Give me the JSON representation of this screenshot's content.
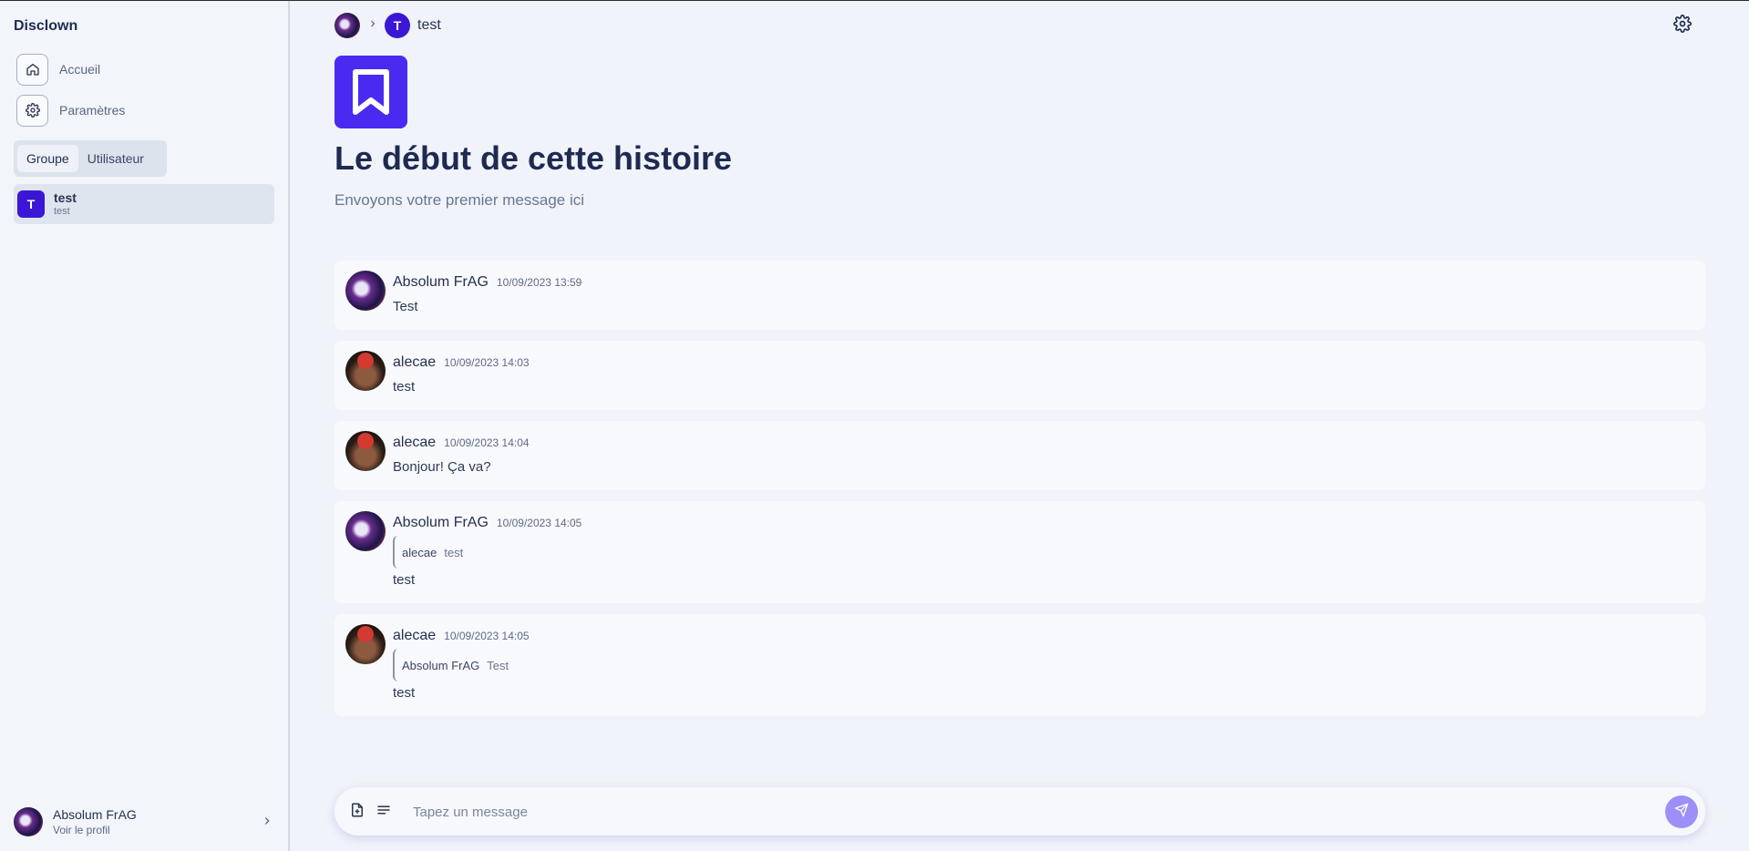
{
  "app": {
    "name": "Disclown"
  },
  "sidebar": {
    "nav": [
      {
        "label": "Accueil",
        "icon": "home-icon"
      },
      {
        "label": "Paramètres",
        "icon": "gear-icon"
      }
    ],
    "tabs": [
      {
        "label": "Groupe",
        "active": true
      },
      {
        "label": "Utilisateur",
        "active": false
      }
    ],
    "conversations": [
      {
        "initial": "T",
        "name": "test",
        "subtitle": "test",
        "color": "#3b16d6"
      }
    ],
    "profile": {
      "name": "Absolum FrAG",
      "link": "Voir le profil"
    }
  },
  "header": {
    "channel_initial": "T",
    "channel_name": "test"
  },
  "hero": {
    "title": "Le début de cette histoire",
    "subtitle": "Envoyons votre premier message ici",
    "icon": "bookmark-icon",
    "color": "#4a2af0"
  },
  "messages": [
    {
      "author": "Absolum FrAG",
      "time": "10/09/2023 13:59",
      "text": "Test"
    },
    {
      "author": "alecae",
      "time": "10/09/2023 14:03",
      "text": "test"
    },
    {
      "author": "alecae",
      "time": "10/09/2023 14:04",
      "text": "Bonjour! Ça va?"
    },
    {
      "author": "Absolum FrAG",
      "time": "10/09/2023 14:05",
      "reply_author": "alecae",
      "reply_text": "test",
      "text": "test"
    },
    {
      "author": "alecae",
      "time": "10/09/2023 14:05",
      "reply_author": "Absolum FrAG",
      "reply_text": "Test",
      "text": "test"
    }
  ],
  "composer": {
    "placeholder": "Tapez un message",
    "icons": [
      "file-plus-icon",
      "menu-lines-icon",
      "send-icon"
    ]
  }
}
